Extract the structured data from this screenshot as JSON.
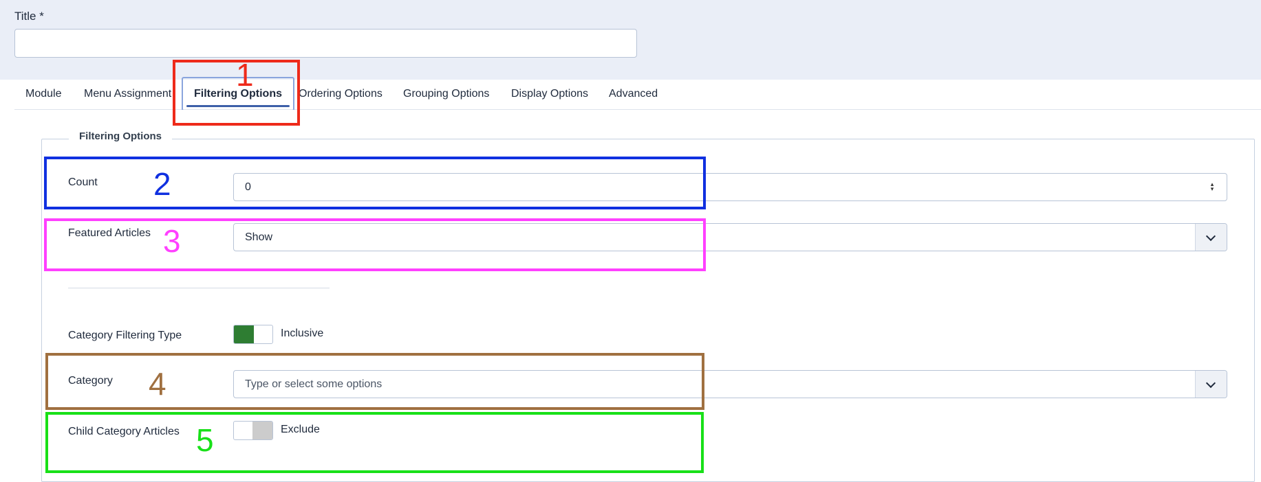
{
  "form": {
    "title_label": "Title *",
    "title_value": ""
  },
  "tabs": [
    {
      "label": "Module"
    },
    {
      "label": "Menu Assignment"
    },
    {
      "label": "Filtering Options",
      "active": true
    },
    {
      "label": "Ordering Options"
    },
    {
      "label": "Grouping Options"
    },
    {
      "label": "Display Options"
    },
    {
      "label": "Advanced"
    }
  ],
  "filtering": {
    "legend": "Filtering Options",
    "count_label": "Count",
    "count_value": "0",
    "featured_label": "Featured Articles",
    "featured_value": "Show",
    "cat_filter_label": "Category Filtering Type",
    "cat_filter_value": "Inclusive",
    "category_label": "Category",
    "category_placeholder": "Type or select some options",
    "child_label": "Child Category Articles",
    "child_value": "Exclude"
  },
  "annotations": [
    {
      "number": "1",
      "color": "#ee2a1a"
    },
    {
      "number": "2",
      "color": "#1030e0"
    },
    {
      "number": "3",
      "color": "#ff40ff"
    },
    {
      "number": "4",
      "color": "#a07040"
    },
    {
      "number": "5",
      "color": "#18e018"
    }
  ]
}
